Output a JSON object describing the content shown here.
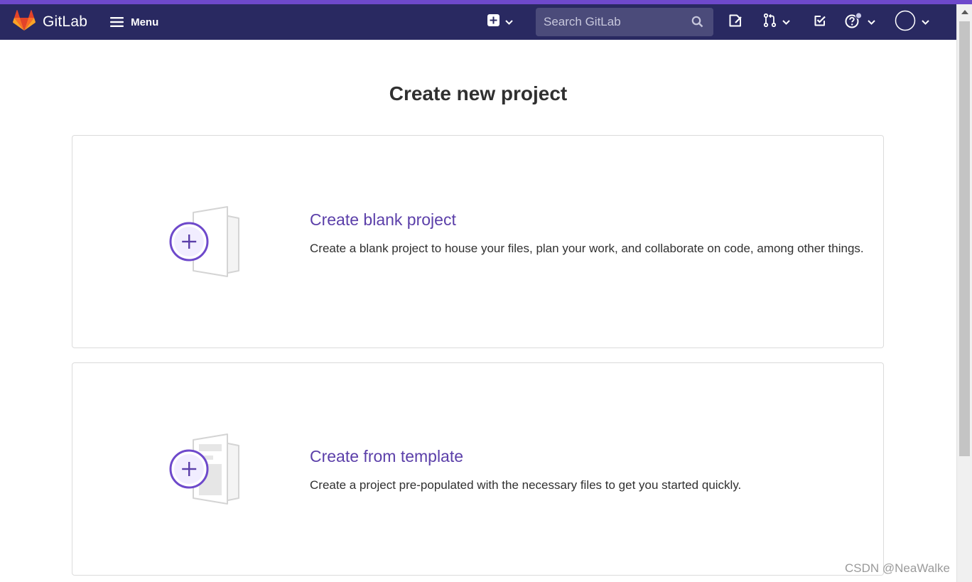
{
  "header": {
    "brand": "GitLab",
    "menu_label": "Menu",
    "search_placeholder": "Search GitLab",
    "accent": "#292961",
    "icons": [
      "gitlab-logo",
      "hamburger-icon",
      "new-item-icon",
      "search-icon",
      "issues-icon",
      "merge-requests-icon",
      "todo-icon",
      "help-icon",
      "avatar"
    ]
  },
  "main": {
    "title": "Create new project",
    "cards": [
      {
        "title": "Create blank project",
        "description": "Create a blank project to house your files, plan your work, and collaborate on code, among other things."
      },
      {
        "title": "Create from template",
        "description": "Create a project pre-populated with the necessary files to get you started quickly."
      }
    ]
  },
  "watermark": "CSDN @NeaWalke",
  "colors": {
    "link": "#5b3fa9",
    "plus_circle": "#6e49cb",
    "top_accent": "#6e49cb"
  }
}
